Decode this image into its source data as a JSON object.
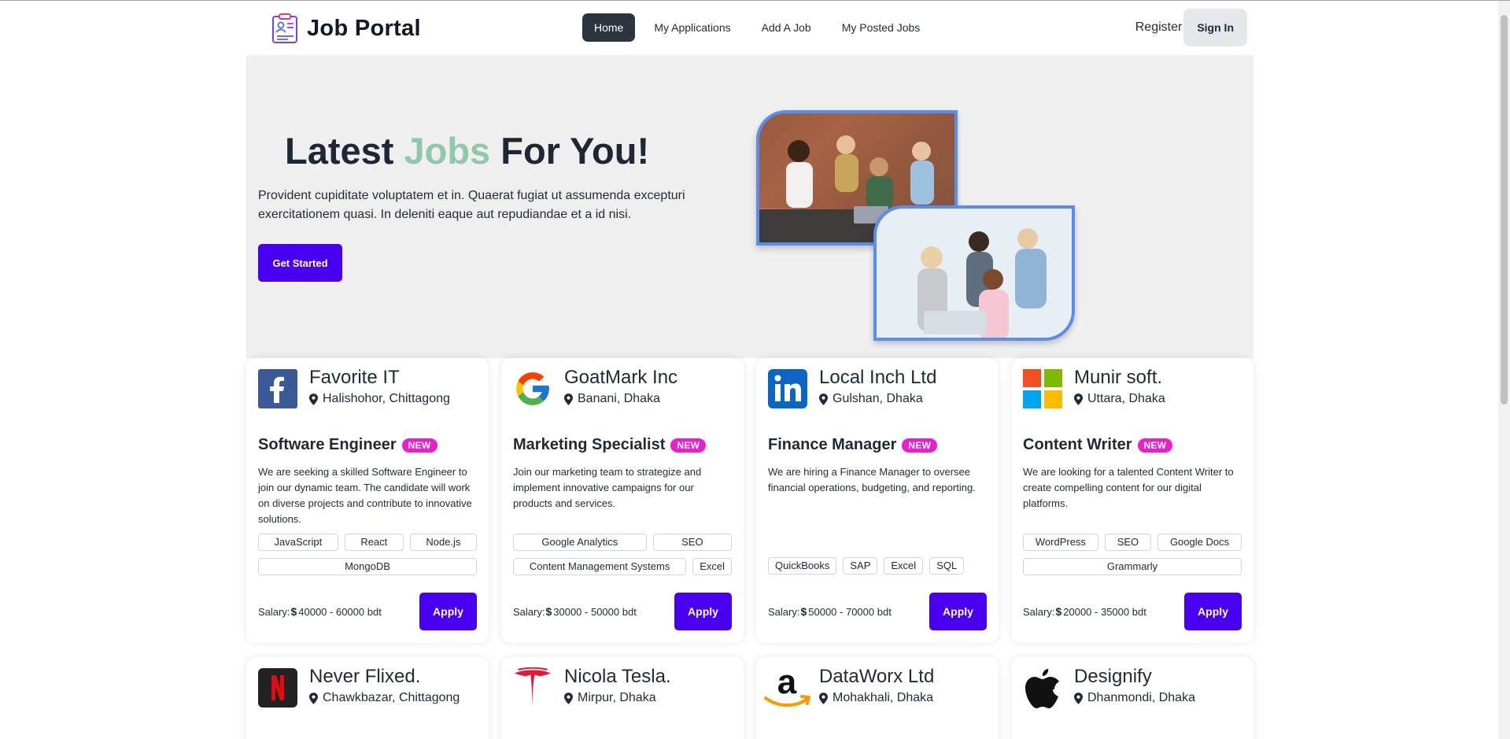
{
  "nav": {
    "brand": "Job Portal",
    "links": [
      "Home",
      "My Applications",
      "Add A Job",
      "My Posted Jobs"
    ],
    "register": "Register",
    "signin": "Sign In"
  },
  "hero": {
    "title_part1": "Latest ",
    "title_accent": "Jobs",
    "title_part2": " For You!",
    "description": "Provident cupiditate voluptatem et in. Quaerat fugiat ut assumenda excepturi exercitationem quasi. In deleniti eaque aut repudiandae et a id nisi.",
    "cta": "Get Started"
  },
  "salary_label": "Salary:",
  "apply_label": "Apply",
  "badge_label": "NEW",
  "jobs": [
    {
      "company": "Favorite IT",
      "location": "Halishohor, Chittagong",
      "title": "Software Engineer",
      "description": "We are seeking a skilled Software Engineer to join our dynamic team. The candidate will work on diverse projects and contribute to innovative solutions.",
      "skills": [
        "JavaScript",
        "React",
        "Node.js",
        "MongoDB"
      ],
      "salary": "40000 - 60000 bdt"
    },
    {
      "company": "GoatMark Inc",
      "location": "Banani, Dhaka",
      "title": "Marketing Specialist",
      "description": "Join our marketing team to strategize and implement innovative campaigns for our products and services.",
      "skills": [
        "Google Analytics",
        "SEO",
        "Content Management Systems",
        "Excel"
      ],
      "salary": "30000 - 50000 bdt"
    },
    {
      "company": "Local Inch Ltd",
      "location": "Gulshan, Dhaka",
      "title": "Finance Manager",
      "description": "We are hiring a Finance Manager to oversee financial operations, budgeting, and reporting.",
      "skills": [
        "QuickBooks",
        "SAP",
        "Excel",
        "SQL"
      ],
      "salary": "50000 - 70000 bdt"
    },
    {
      "company": "Munir soft.",
      "location": "Uttara, Dhaka",
      "title": "Content Writer",
      "description": "We are looking for a talented Content Writer to create compelling content for our digital platforms.",
      "skills": [
        "WordPress",
        "SEO",
        "Google Docs",
        "Grammarly"
      ],
      "salary": "20000 - 35000 bdt"
    },
    {
      "company": "Never Flixed.",
      "location": "Chawkbazar, Chittagong"
    },
    {
      "company": "Nicola Tesla.",
      "location": "Mirpur, Dhaka"
    },
    {
      "company": "DataWorx Ltd",
      "location": "Mohakhali, Dhaka"
    },
    {
      "company": "Designify",
      "location": "Dhanmondi, Dhaka"
    }
  ],
  "colors": {
    "primary": "#4a00f0",
    "badge": "#e91ece",
    "accent": "#8fc9a9",
    "nav_active": "#2b3540"
  }
}
